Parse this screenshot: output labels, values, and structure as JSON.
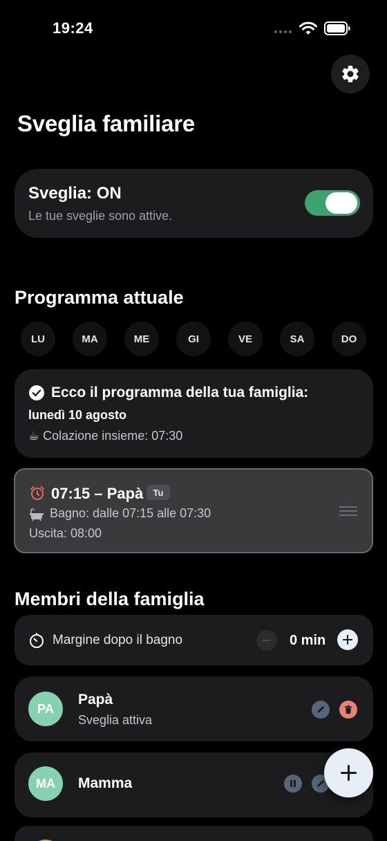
{
  "status_bar": {
    "time": "19:24"
  },
  "header": {
    "title": "Sveglia familiare",
    "settings_icon": "gear-icon"
  },
  "alarm": {
    "title": "Sveglia: ON",
    "subtitle": "Le tue sveglie sono attive.",
    "enabled": true,
    "accent": "#3fa16f"
  },
  "program": {
    "section_title": "Programma attuale",
    "days": [
      "LU",
      "MA",
      "ME",
      "GI",
      "VE",
      "SA",
      "DO"
    ],
    "summary": {
      "heading": "Ecco il programma della tua famiglia:",
      "date": "lunedì 10 agosto",
      "breakfast": "☕ Colazione insieme: 07:30"
    },
    "entry": {
      "title": "07:15 – Papà",
      "tag": "Tu",
      "bath": "Bagno: dalle 07:15 alle 07:30",
      "exit": "Uscita: 08:00"
    }
  },
  "members": {
    "section_title": "Membri della famiglia",
    "margin": {
      "label": "Margine dopo il bagno",
      "value": "0 min"
    },
    "list": [
      {
        "initials": "PA",
        "name": "Papà",
        "status": "Sveglia attiva"
      },
      {
        "initials": "MA",
        "name": "Mamma",
        "status": ""
      }
    ]
  },
  "colors": {
    "background": "#000000",
    "card": "#1c1c1e",
    "avatar": "#86d2b0",
    "delete": "#e98173",
    "edit": "#56657a"
  }
}
